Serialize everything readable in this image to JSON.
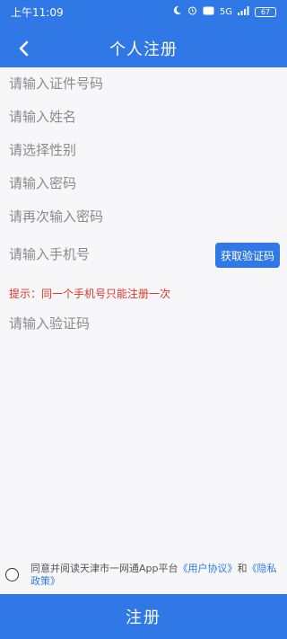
{
  "status_bar": {
    "time": "上午11:09",
    "signal": "5G",
    "battery": "67"
  },
  "header": {
    "title": "个人注册"
  },
  "form": {
    "id_number_placeholder": "请输入证件号码",
    "name_placeholder": "请输入姓名",
    "gender_placeholder": "请选择性别",
    "password_placeholder": "请输入密码",
    "confirm_password_placeholder": "请再次输入密码",
    "phone_placeholder": "请输入手机号",
    "sms_button_label": "获取验证码",
    "tip": "提示：同一个手机号只能注册一次",
    "code_placeholder": "请输入验证码"
  },
  "agreement": {
    "prefix": "同意并阅读天津市一网通App平台",
    "user_agreement": "《用户协议》",
    "and": "和",
    "privacy_policy": "《隐私政策》",
    "checked": false
  },
  "submit_label": "注册",
  "colors": {
    "primary": "#2f78e6",
    "tip": "#e0352b",
    "background": "#f7f7f9"
  }
}
